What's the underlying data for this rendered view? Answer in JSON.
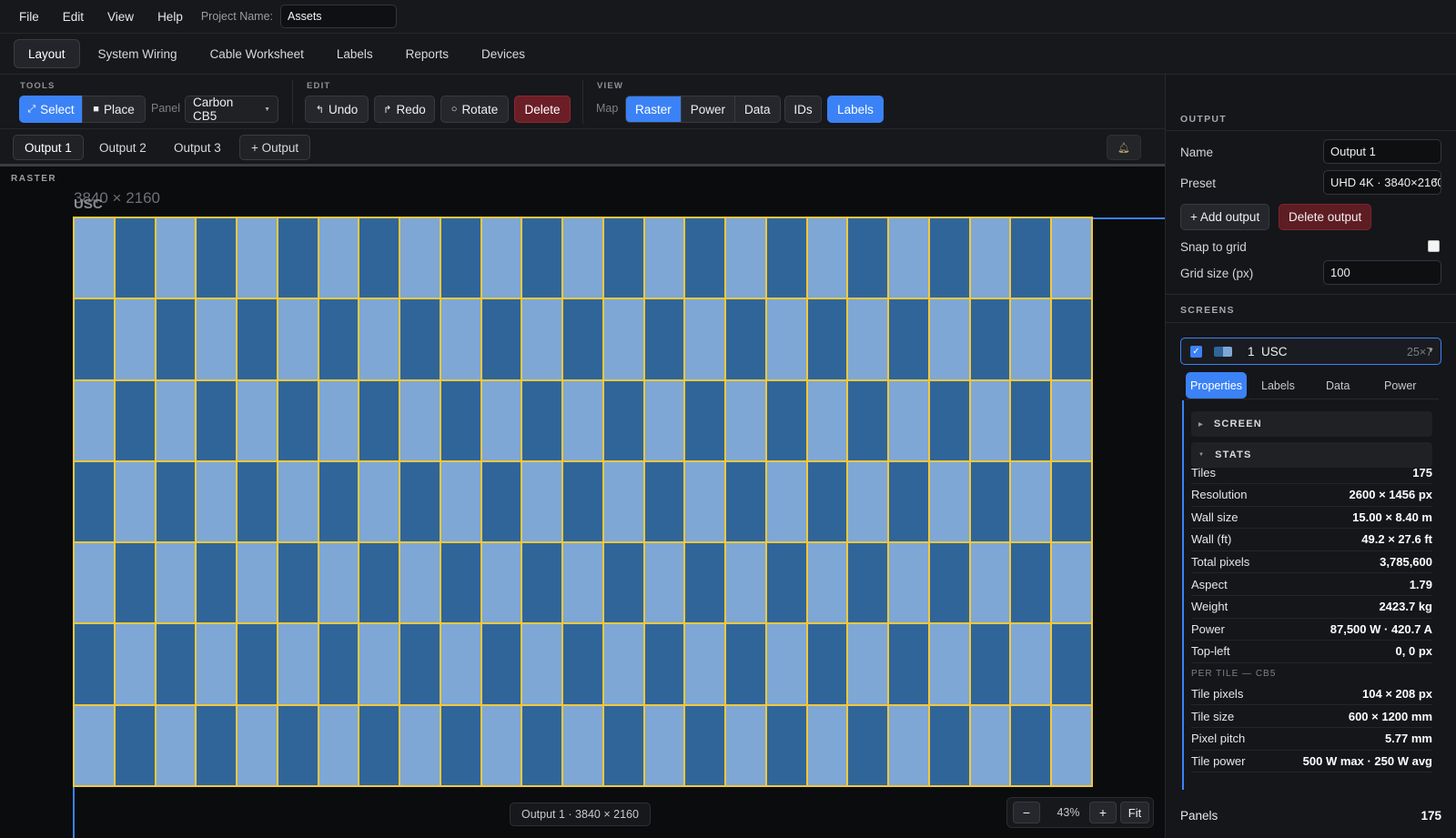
{
  "menu": {
    "items": [
      "File",
      "Edit",
      "View",
      "Help"
    ],
    "project_label": "Project Name:",
    "project_value": "Assets"
  },
  "tabs": [
    "Layout",
    "System Wiring",
    "Cable Worksheet",
    "Labels",
    "Reports",
    "Devices"
  ],
  "toolbar": {
    "tools_label": "TOOLS",
    "edit_label": "EDIT",
    "view_label": "VIEW",
    "select": "Select",
    "place": "Place",
    "panel_label": "Panel",
    "panel_value": "Carbon CB5",
    "undo": "Undo",
    "redo": "Redo",
    "rotate": "Rotate",
    "delete": "Delete",
    "map_label": "Map",
    "map_modes": [
      "Raster",
      "Power",
      "Data"
    ],
    "ids": "IDs",
    "labels": "Labels"
  },
  "outputs": {
    "tabs": [
      "Output 1",
      "Output 2",
      "Output 3"
    ],
    "add": "+ Output"
  },
  "canvas": {
    "section_label": "RASTER",
    "raster_dims": "3840 × 2160",
    "screen_name": "USC",
    "cols": 25,
    "rows": 7,
    "footer": "Output 1 · 3840 × 2160",
    "zoom_minus": "−",
    "zoom": "43%",
    "zoom_plus": "+",
    "fit": "Fit"
  },
  "output_panel": {
    "title": "OUTPUT",
    "name_label": "Name",
    "name_value": "Output 1",
    "preset_label": "Preset",
    "preset_value": "UHD 4K · 3840×2160",
    "add_output": "+ Add output",
    "delete_output": "Delete output",
    "snap_label": "Snap to grid",
    "grid_label": "Grid size (px)",
    "grid_value": "100"
  },
  "screens_panel": {
    "title": "SCREENS",
    "screen": {
      "index": "1",
      "name": "USC",
      "size": "25×7"
    },
    "tabs": [
      "Properties",
      "Labels",
      "Data",
      "Power"
    ],
    "screen_section": "SCREEN",
    "stats_section": "STATS",
    "stats": [
      {
        "k": "Tiles",
        "v": "175"
      },
      {
        "k": "Resolution",
        "v": "2600 × 1456 px"
      },
      {
        "k": "Wall size",
        "v": "15.00 × 8.40 m"
      },
      {
        "k": "Wall (ft)",
        "v": "49.2 × 27.6 ft"
      },
      {
        "k": "Total pixels",
        "v": "3,785,600"
      },
      {
        "k": "Aspect",
        "v": "1.79"
      },
      {
        "k": "Weight",
        "v": "2423.7 kg"
      },
      {
        "k": "Power",
        "v": "87,500 W · 420.7 A"
      },
      {
        "k": "Top-left",
        "v": "0, 0 px"
      }
    ],
    "per_tile_label": "PER TILE — CB5",
    "per_tile": [
      {
        "k": "Tile pixels",
        "v": "104 × 208 px"
      },
      {
        "k": "Tile size",
        "v": "600 × 1200 mm"
      },
      {
        "k": "Pixel pitch",
        "v": "5.77 mm"
      },
      {
        "k": "Tile power",
        "v": "500 W max · 250 W avg"
      }
    ],
    "panels_label": "Panels",
    "panels_value": "175"
  },
  "colors": {
    "accent": "#3b82f6",
    "tile_light": "#7ea7d6",
    "tile_dark": "#30659a",
    "tile_border": "#f4c83a",
    "danger": "#6b1e26"
  }
}
